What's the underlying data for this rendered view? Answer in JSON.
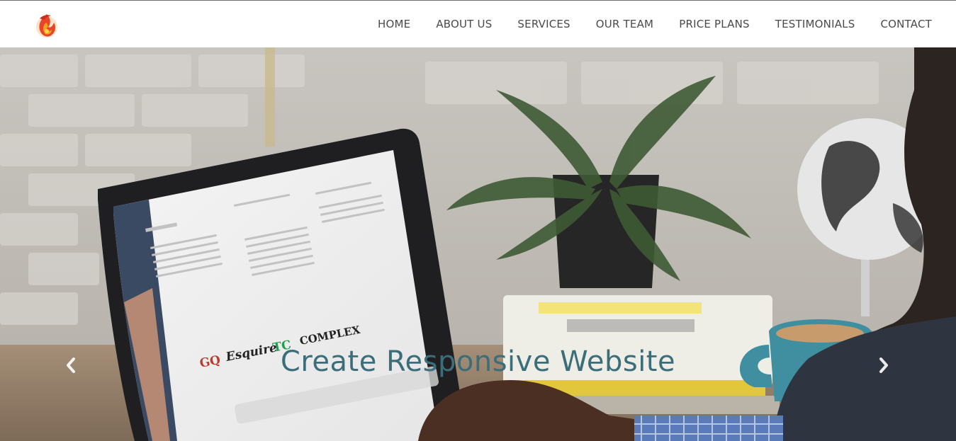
{
  "brand": {
    "logo_icon": "phoenix-flame-logo",
    "accent": "#e8442a"
  },
  "nav": {
    "items": [
      {
        "label": "HOME"
      },
      {
        "label": "ABOUT US"
      },
      {
        "label": "SERVICES"
      },
      {
        "label": "OUR TEAM"
      },
      {
        "label": "PRICE PLANS"
      },
      {
        "label": "TESTIMONIALS"
      },
      {
        "label": "CONTACT"
      }
    ]
  },
  "hero": {
    "caption": "Create Responsive Website",
    "caption_color": "#3b6e7a",
    "prev_icon": "chevron-left-icon",
    "next_icon": "chevron-right-icon",
    "laptop_brands": [
      "GQ",
      "Esquire",
      "TC",
      "COMPLEX"
    ]
  }
}
